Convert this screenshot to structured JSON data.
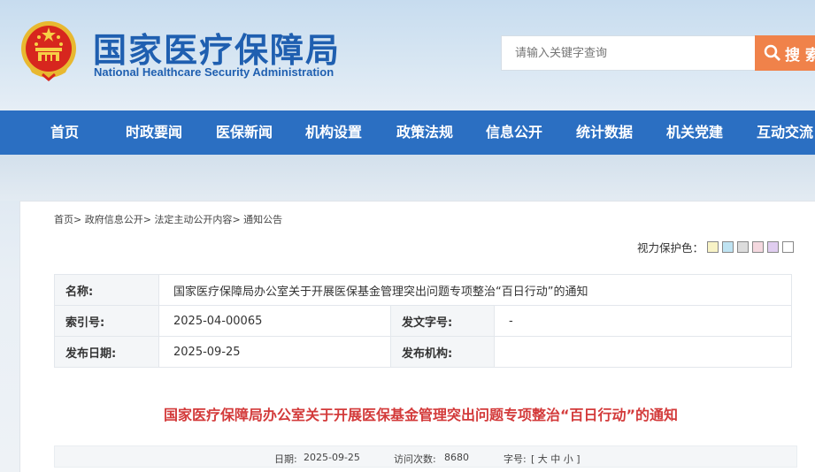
{
  "header": {
    "title_cn": "国家医疗保障局",
    "title_en": "National Healthcare Security Administration",
    "search_placeholder": "请输入关键字查询",
    "search_button": "搜 索"
  },
  "nav": {
    "items": [
      "首页",
      "时政要闻",
      "医保新闻",
      "机构设置",
      "政策法规",
      "信息公开",
      "统计数据",
      "机关党建",
      "互动交流"
    ]
  },
  "breadcrumb": [
    "首页",
    "政府信息公开",
    "法定主动公开内容",
    "通知公告"
  ],
  "eye_protect": {
    "label": "视力保护色：",
    "colors": [
      "#f8f3c6",
      "#bfe3f2",
      "#dcdcdc",
      "#f4d8df",
      "#e0cdf0",
      "#ffffff"
    ]
  },
  "meta": {
    "name_label": "名称:",
    "name_value": "国家医疗保障局办公室关于开展医保基金管理突出问题专项整治“百日行动”的通知",
    "index_label": "索引号:",
    "index_value": "2025-04-00065",
    "docno_label": "发文字号:",
    "docno_value": "-",
    "date_label": "发布日期:",
    "date_value": "2025-09-25",
    "org_label": "发布机构:",
    "org_value": ""
  },
  "article": {
    "title": "国家医疗保障局办公室关于开展医保基金管理突出问题专项整治“百日行动”的通知",
    "date_label": "日期:",
    "date": "2025-09-25",
    "visits_label": "访问次数:",
    "visits": "8680",
    "fontsize_label": "字号:",
    "fontsize_options": "[ 大 中 小 ]"
  }
}
